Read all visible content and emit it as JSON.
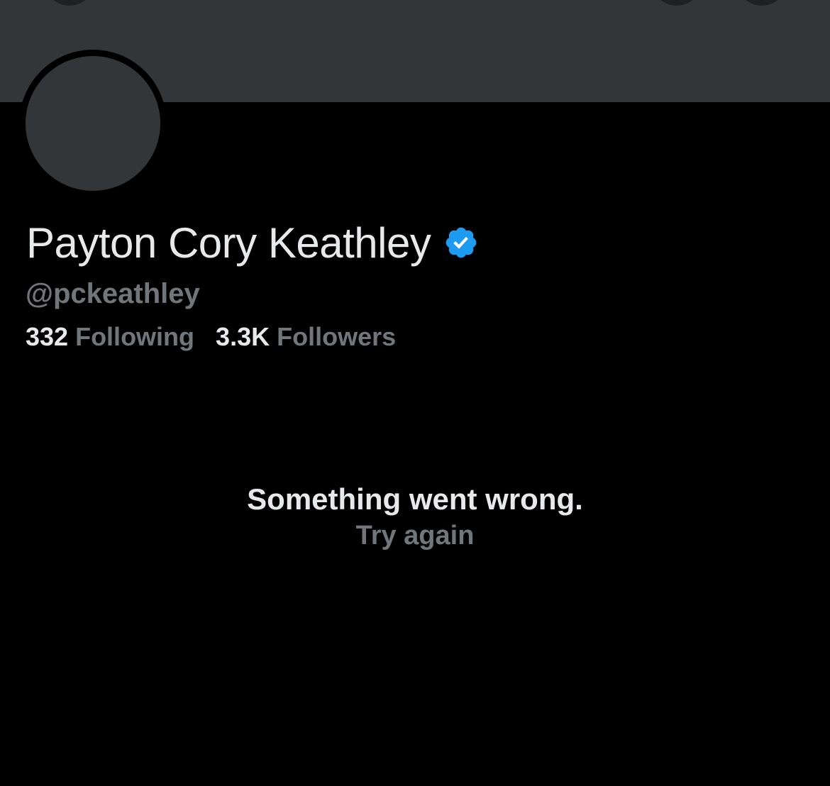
{
  "profile": {
    "display_name": "Payton Cory Keathley",
    "handle": "@pckeathley",
    "verified": true,
    "verified_color": "#1d9bf0",
    "stats": {
      "following_count": "332",
      "following_label": "Following",
      "followers_count": "3.3K",
      "followers_label": "Followers"
    }
  },
  "error": {
    "message": "Something went wrong.",
    "retry_label": "Try again"
  },
  "header": {
    "icons": [
      "back-arrow-icon",
      "search-icon",
      "more-icon"
    ]
  },
  "colors": {
    "background": "#000000",
    "banner": "#333639",
    "primary_text": "#e7e9ea",
    "secondary_text": "#71767b"
  }
}
